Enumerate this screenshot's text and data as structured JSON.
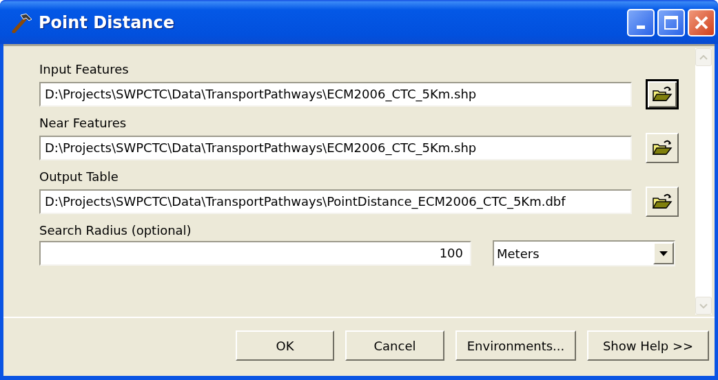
{
  "window": {
    "title": "Point Distance"
  },
  "parameters": [
    {
      "kind": "file",
      "label": "Input Features",
      "value": "D:\\Projects\\SWPCTC\\Data\\TransportPathways\\ECM2006_CTC_5Km.shp",
      "focused": true
    },
    {
      "kind": "file",
      "label": "Near Features",
      "value": "D:\\Projects\\SWPCTC\\Data\\TransportPathways\\ECM2006_CTC_5Km.shp",
      "focused": false
    },
    {
      "kind": "file",
      "label": "Output Table",
      "value": "D:\\Projects\\SWPCTC\\Data\\TransportPathways\\PointDistance_ECM2006_CTC_5Km.dbf",
      "focused": false
    },
    {
      "kind": "linear",
      "label": "Search Radius (optional)",
      "value": "100",
      "unit": "Meters"
    }
  ],
  "buttons": [
    "OK",
    "Cancel",
    "Environments...",
    "Show Help >>"
  ]
}
